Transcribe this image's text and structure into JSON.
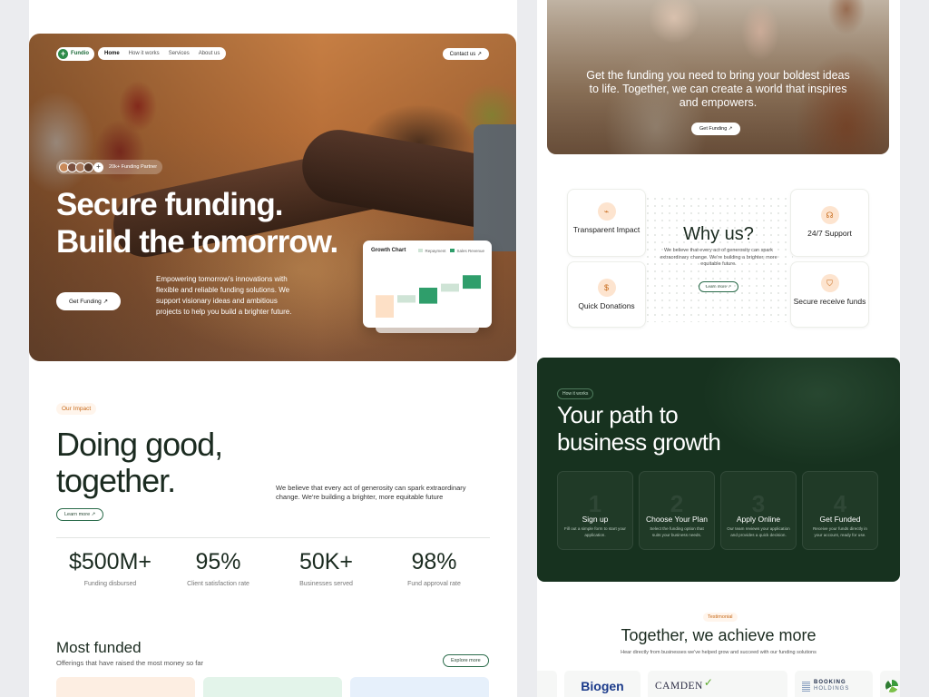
{
  "nav": {
    "brand": "Fundio",
    "links": [
      "Home",
      "How it works",
      "Services",
      "About us"
    ],
    "contact": "Contact us ↗"
  },
  "hero": {
    "partners": "20k+ Funding Partner",
    "plus": "+",
    "title": "Secure funding.\nBuild the tomorrow.",
    "desc": "Empowering tomorrow's innovations with flexible and reliable funding solutions. We support visionary ideas and ambitious projects to help you build a brighter future.",
    "button": "Get Funding ↗"
  },
  "growth_chart": {
    "title": "Growth Chart",
    "legend": [
      "Repayment",
      "Sales Revenue"
    ],
    "colors": {
      "repayment": "#cfe4d6",
      "sales": "#2f9e6b",
      "start": "#fde0c6"
    }
  },
  "chart_data": {
    "type": "bar",
    "title": "Growth Chart",
    "series": [
      {
        "name": "Repayment"
      },
      {
        "name": "Sales Revenue"
      }
    ],
    "bars": [
      {
        "base": 0,
        "top": 45,
        "series": "start"
      },
      {
        "base": 30,
        "top": 45,
        "series": "Repayment"
      },
      {
        "base": 28,
        "top": 60,
        "series": "Sales Revenue"
      },
      {
        "base": 52,
        "top": 68,
        "series": "Repayment"
      },
      {
        "base": 58,
        "top": 85,
        "series": "Sales Revenue"
      }
    ],
    "ylim": [
      0,
      100
    ],
    "grid": false,
    "legend": "top-right"
  },
  "impact": {
    "tag": "Our Impact",
    "title": "Doing good,\ntogether.",
    "desc": "We believe that every act of generosity can spark extraordinary change. We're building a brighter, more equitable future",
    "learn": "Learn more ↗",
    "stats": [
      {
        "value": "$500M+",
        "label": "Funding disbursed"
      },
      {
        "value": "95%",
        "label": "Client satisfaction rate"
      },
      {
        "value": "50K+",
        "label": "Businesses served"
      },
      {
        "value": "98%",
        "label": "Fund approval rate"
      }
    ]
  },
  "most_funded": {
    "title": "Most funded",
    "sub": "Offerings that have raised the most money so far",
    "explore": "Explore more",
    "card_colors": [
      "#fdeee2",
      "#e3f4ea",
      "#e6f0fb"
    ]
  },
  "right_hero": {
    "text": "Get the funding you need to bring your boldest ideas to life. Together, we can create a world that inspires and empowers.",
    "button": "Get Funding ↗"
  },
  "why": {
    "title": "Why us?",
    "desc": "We believe that every act of generosity can spark extraordinary change. We're building a brighter, more equitable future.",
    "learn": "Learn more ↗",
    "cards": [
      {
        "label": "Transparent Impact",
        "icon": "chart-icon"
      },
      {
        "label": "24/7 Support",
        "icon": "headset-icon"
      },
      {
        "label": "Quick Donations",
        "icon": "coin-icon"
      },
      {
        "label": "Secure receive funds",
        "icon": "shield-icon"
      }
    ]
  },
  "how": {
    "tag": "How it works",
    "title": "Your path to\nbusiness growth",
    "steps": [
      {
        "num": "1",
        "title": "Sign up",
        "desc": "Fill out a simple form to start your application."
      },
      {
        "num": "2",
        "title": "Choose Your Plan",
        "desc": "Select the funding option that suits your business needs."
      },
      {
        "num": "3",
        "title": "Apply Online",
        "desc": "Our team reviews your application and provides a quick decision."
      },
      {
        "num": "4",
        "title": "Get Funded",
        "desc": "Receive your funds directly in your account, ready for use."
      }
    ]
  },
  "testimonial": {
    "tag": "Testimonial",
    "title": "Together, we achieve more",
    "sub": "Hear directly from businesses we've helped grow and succeed with our funding solutions",
    "logos": [
      "Biogen",
      "CAMDEN",
      "BOOKING",
      "HOLDINGS"
    ]
  }
}
